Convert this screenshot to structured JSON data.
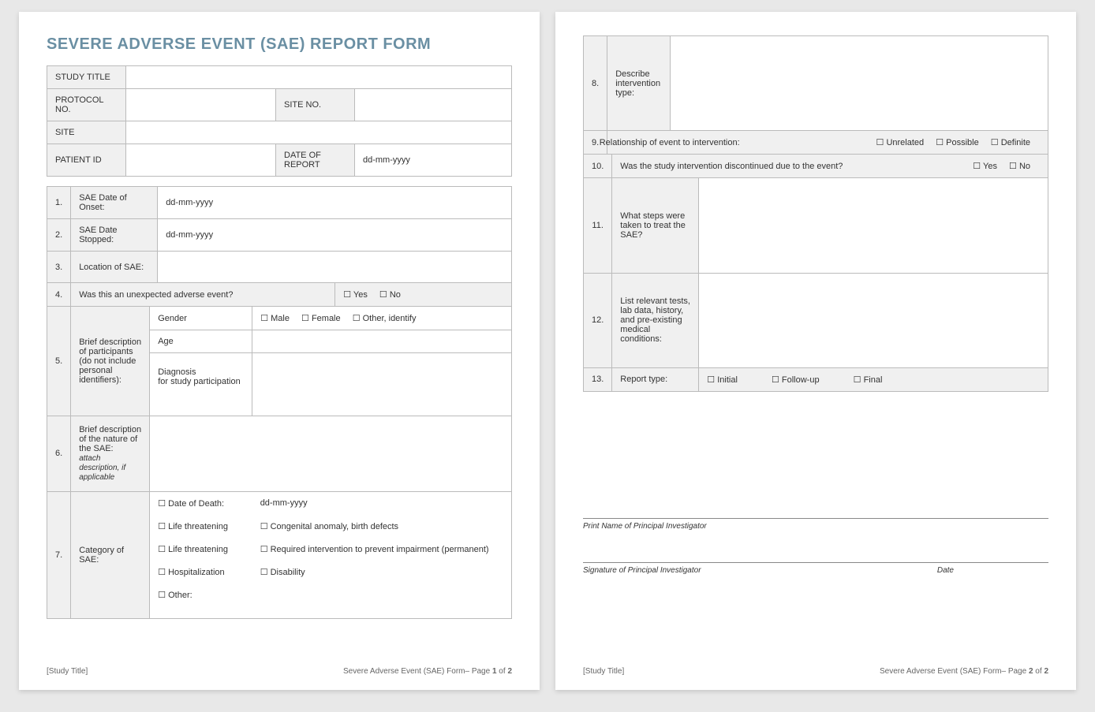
{
  "title": "SEVERE ADVERSE EVENT (SAE) REPORT FORM",
  "header": {
    "study_title": "STUDY TITLE",
    "protocol_no": "PROTOCOL NO.",
    "site_no": "SITE NO.",
    "site": "SITE",
    "patient_id": "PATIENT ID",
    "date_of_report": "DATE OF REPORT",
    "date_placeholder": "dd-mm-yyyy"
  },
  "rows": {
    "r1": {
      "n": "1.",
      "label": "SAE Date of Onset:",
      "val": "dd-mm-yyyy"
    },
    "r2": {
      "n": "2.",
      "label": "SAE Date Stopped:",
      "val": "dd-mm-yyyy"
    },
    "r3": {
      "n": "3.",
      "label": "Location of SAE:"
    },
    "r4": {
      "n": "4.",
      "label": "Was this an unexpected adverse event?",
      "yes": "Yes",
      "no": "No"
    },
    "r5": {
      "n": "5.",
      "label": "Brief description of participants (do not include personal identifiers):",
      "gender": "Gender",
      "male": "Male",
      "female": "Female",
      "other": "Other, identify",
      "age": "Age",
      "diag": "Diagnosis",
      "diag2": "for study participation"
    },
    "r6": {
      "n": "6.",
      "label": "Brief description of the nature of the SAE:",
      "sub": "attach description, if applicable"
    },
    "r7": {
      "n": "7.",
      "label": "Category of SAE:",
      "dod": "Date of Death:",
      "dod_val": "dd-mm-yyyy",
      "lt1": "Life threatening",
      "cong": "Congenital anomaly, birth defects",
      "lt2": "Life threatening",
      "req": "Required intervention to prevent impairment (permanent)",
      "hosp": "Hospitalization",
      "dis": "Disability",
      "other": "Other:"
    },
    "r8": {
      "n": "8.",
      "label": "Describe intervention type:"
    },
    "r9": {
      "n": "9.",
      "label": "Relationship of event to intervention:",
      "unrel": "Unrelated",
      "poss": "Possible",
      "def": "Definite"
    },
    "r10": {
      "n": "10.",
      "label": "Was the study intervention discontinued due to the event?",
      "yes": "Yes",
      "no": "No"
    },
    "r11": {
      "n": "11.",
      "label": "What steps were taken to treat the SAE?"
    },
    "r12": {
      "n": "12.",
      "label": "List relevant tests, lab data, history, and pre-existing medical conditions:"
    },
    "r13": {
      "n": "13.",
      "label": "Report type:",
      "init": "Initial",
      "fu": "Follow-up",
      "fin": "Final"
    }
  },
  "sig": {
    "print": "Print Name of Principal Investigator",
    "sign": "Signature of Principal Investigator",
    "date": "Date"
  },
  "footer": {
    "left": "[Study Title]",
    "right_pre": "Severe Adverse Event (SAE) Form– Page ",
    "of": " of ",
    "p1": "1",
    "p2": "2",
    "total": "2"
  }
}
